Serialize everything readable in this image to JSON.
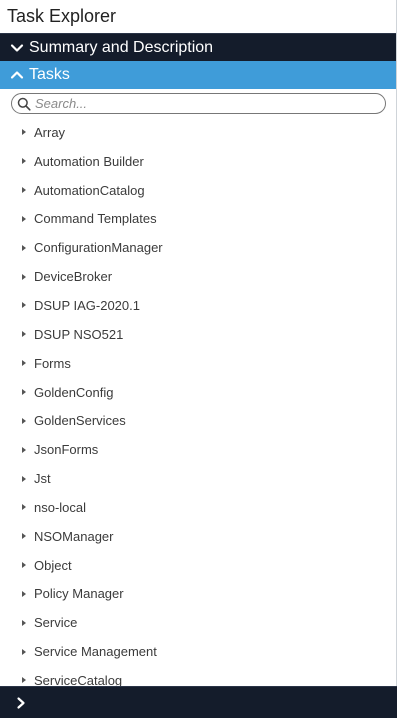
{
  "window": {
    "title": "Task Explorer"
  },
  "sections": {
    "summary": {
      "label": "Summary and Description",
      "expanded": false
    },
    "tasks": {
      "label": "Tasks",
      "expanded": true
    }
  },
  "search": {
    "placeholder": "Search...",
    "value": ""
  },
  "tasks": [
    "Array",
    "Automation Builder",
    "AutomationCatalog",
    "Command Templates",
    "ConfigurationManager",
    "DeviceBroker",
    "DSUP IAG-2020.1",
    "DSUP NSO521",
    "Forms",
    "GoldenConfig",
    "GoldenServices",
    "JsonForms",
    "Jst",
    "nso-local",
    "NSOManager",
    "Object",
    "Policy Manager",
    "Service",
    "Service Management",
    "ServiceCatalog"
  ],
  "colors": {
    "dark_header": "#141c2b",
    "accent_header": "#3f9cd9"
  },
  "icons": {
    "summary_toggle": "chevron-down-icon",
    "tasks_toggle": "chevron-up-icon",
    "search": "search-icon",
    "task_expand": "caret-right-icon",
    "footer_toggle": "chevron-right-icon"
  }
}
